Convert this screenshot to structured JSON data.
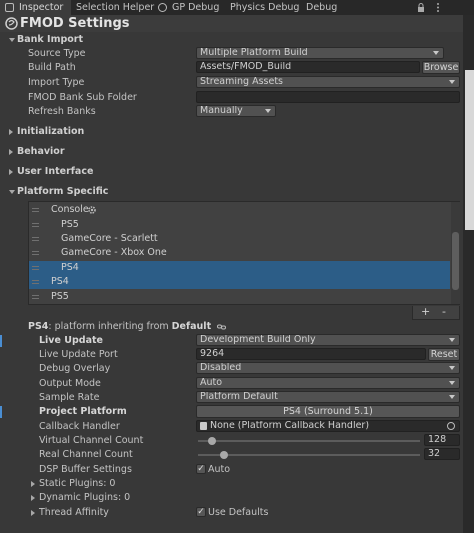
{
  "tabs": [
    {
      "label": "Inspector",
      "active": true
    },
    {
      "label": "Selection Helper"
    },
    {
      "label": "GP Debug"
    },
    {
      "label": "Physics Debug"
    },
    {
      "label": "Debug"
    }
  ],
  "title": "FMOD Settings",
  "bank_import": {
    "header": "Bank Import",
    "source_type_label": "Source Type",
    "source_type_value": "Multiple Platform Build",
    "build_path_label": "Build Path",
    "build_path_value": "Assets/FMOD_Build",
    "browse_label": "Browse",
    "import_type_label": "Import Type",
    "import_type_value": "Streaming Assets",
    "subfolder_label": "FMOD Bank Sub Folder",
    "refresh_label": "Refresh Banks",
    "refresh_value": "Manually"
  },
  "sections": {
    "initialization": "Initialization",
    "behavior": "Behavior",
    "user_interface": "User Interface",
    "platform_specific": "Platform Specific"
  },
  "platform_list": [
    {
      "label": "Console",
      "indent": 1
    },
    {
      "label": "PS5",
      "indent": 2
    },
    {
      "label": "GameCore - Scarlett",
      "indent": 2
    },
    {
      "label": "GameCore - Xbox One",
      "indent": 2
    },
    {
      "label": "PS4",
      "indent": 2,
      "selected": true
    },
    {
      "label": "PS4",
      "indent": 1,
      "selected": true
    },
    {
      "label": "PS5",
      "indent": 1
    }
  ],
  "list_buttons": {
    "add": "+",
    "remove": "-"
  },
  "inherit": {
    "platform": "PS4",
    "text": ": platform inheriting from ",
    "parent": "Default"
  },
  "props": {
    "live_update_label": "Live Update",
    "live_update_value": "Development Build Only",
    "live_update_port_label": "Live Update Port",
    "live_update_port_value": "9264",
    "reset_label": "Reset",
    "debug_overlay_label": "Debug Overlay",
    "debug_overlay_value": "Disabled",
    "output_mode_label": "Output Mode",
    "output_mode_value": "Auto",
    "sample_rate_label": "Sample Rate",
    "sample_rate_value": "Platform Default",
    "project_platform_label": "Project Platform",
    "project_platform_value": "PS4 (Surround 5.1)",
    "callback_label": "Callback Handler",
    "callback_value": "None (Platform Callback Handler)",
    "virtual_channel_label": "Virtual Channel Count",
    "virtual_channel_value": "128",
    "real_channel_label": "Real Channel Count",
    "real_channel_value": "32",
    "dsp_label": "DSP Buffer Settings",
    "dsp_check_label": "Auto",
    "static_plugins_label": "Static Plugins: 0",
    "dynamic_plugins_label": "Dynamic Plugins: 0",
    "thread_affinity_label": "Thread Affinity",
    "thread_check_label": "Use Defaults"
  },
  "colors": {
    "background": "#383838",
    "selection": "#2c5d87",
    "modified_bar": "#4a8ed3"
  }
}
